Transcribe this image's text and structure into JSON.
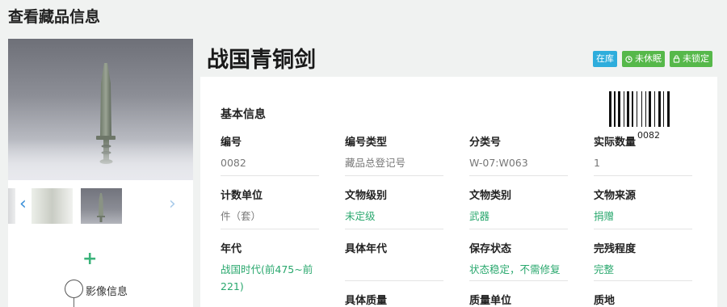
{
  "page": {
    "title": "查看藏品信息"
  },
  "artifact": {
    "name": "战国青铜剑"
  },
  "badges": [
    {
      "label": "在库",
      "color": "#2eaddc",
      "icon": ""
    },
    {
      "label": "未休眠",
      "color": "#56b84a",
      "icon": "clock-icon"
    },
    {
      "label": "未锁定",
      "color": "#56b84a",
      "icon": "lock-icon"
    }
  ],
  "gallery": {
    "prev_icon": "chevron-left-icon",
    "next_icon": "chevron-right-icon",
    "add_icon": "plus-icon",
    "image_info_label": "影像信息"
  },
  "basic_info": {
    "section_title": "基本信息",
    "barcode_number": "0082",
    "fields": [
      {
        "label": "编号",
        "value": "0082",
        "style": "gray"
      },
      {
        "label": "编号类型",
        "value": "藏品总登记号",
        "style": "gray"
      },
      {
        "label": "分类号",
        "value": "W-07:W063",
        "style": "gray"
      },
      {
        "label": "实际数量",
        "value": "1",
        "style": "gray"
      },
      {
        "label": "计数单位",
        "value": "件（套）",
        "style": "gray"
      },
      {
        "label": "文物级别",
        "value": "未定级",
        "style": "green"
      },
      {
        "label": "文物类别",
        "value": "武器",
        "style": "green"
      },
      {
        "label": "文物来源",
        "value": "捐赠",
        "style": "green"
      },
      {
        "label": "年代",
        "value": "战国时代(前475~前221)",
        "style": "green"
      },
      {
        "label": "具体年代",
        "value": "",
        "style": "gray"
      },
      {
        "label": "保存状态",
        "value": "状态稳定，不需修复",
        "style": "green"
      },
      {
        "label": "完残程度",
        "value": "完整",
        "style": "green"
      },
      {
        "label": "具体质量",
        "value": "",
        "style": "gray"
      },
      {
        "label": "质量单位",
        "value": "",
        "style": "gray"
      },
      {
        "label": "质地",
        "value": "",
        "style": "gray"
      }
    ]
  }
}
